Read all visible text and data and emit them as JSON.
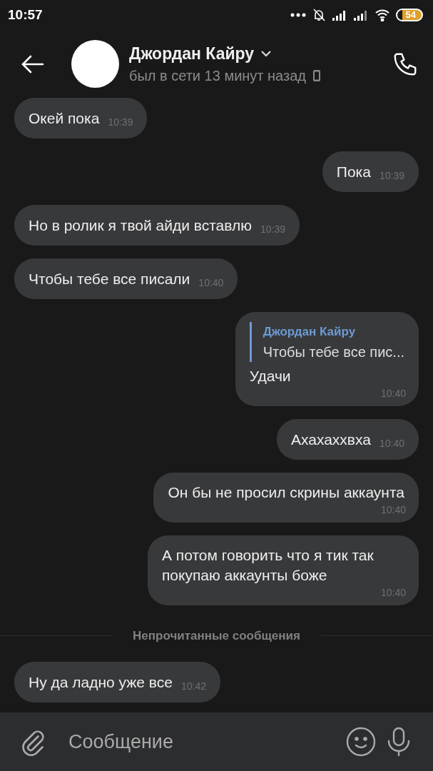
{
  "status_bar": {
    "time": "10:57",
    "battery": "54"
  },
  "header": {
    "name": "Джордан Кайру",
    "status": "был в сети 13 минут назад"
  },
  "messages": [
    {
      "kind": "incoming",
      "time_below": false,
      "text": "Окей пока",
      "time": "10:39"
    },
    {
      "kind": "outgoing",
      "time_below": false,
      "text": "Пока",
      "time": "10:39"
    },
    {
      "kind": "incoming",
      "time_below": false,
      "text": "Но в ролик я твой айди вставлю",
      "time": "10:39"
    },
    {
      "kind": "incoming",
      "time_below": false,
      "text": "Чтобы тебе все писали",
      "time": "10:40"
    },
    {
      "kind": "outgoing",
      "time_below": true,
      "reply": {
        "author": "Джордан Кайру",
        "text": "Чтобы тебе все пис..."
      },
      "text": "Удачи",
      "time": "10:40"
    },
    {
      "kind": "outgoing",
      "time_below": false,
      "text": "Ахахаххвха",
      "time": "10:40"
    },
    {
      "kind": "outgoing",
      "time_below": true,
      "text": "Он бы не просил скрины аккаунта",
      "time": "10:40"
    },
    {
      "kind": "outgoing",
      "time_below": true,
      "text": "А потом говорить что я тик так покупаю аккаунты боже",
      "time": "10:40"
    },
    {
      "kind": "divider",
      "text": "Непрочитанные сообщения"
    },
    {
      "kind": "incoming",
      "time_below": false,
      "text": "Ну да ладно уже все",
      "time": "10:42"
    }
  ],
  "composer": {
    "placeholder": "Сообщение"
  }
}
